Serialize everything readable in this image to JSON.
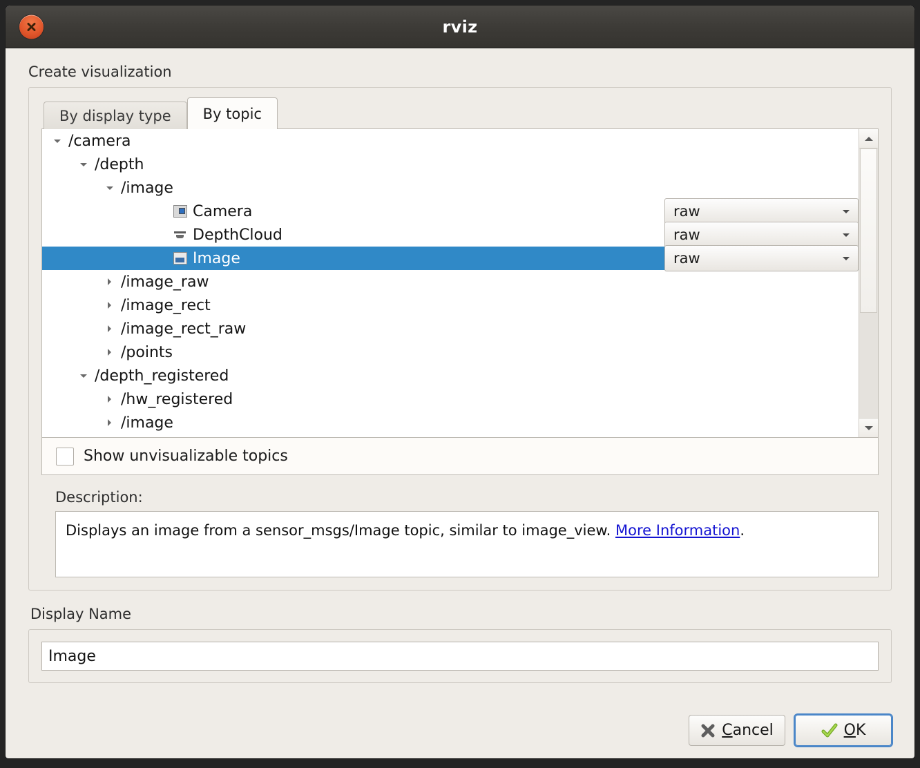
{
  "window": {
    "title": "rviz",
    "close_icon": "close-icon"
  },
  "group": {
    "title": "Create visualization"
  },
  "tabs": [
    {
      "label": "By display type",
      "active": false
    },
    {
      "label": "By topic",
      "active": true
    }
  ],
  "tree": {
    "rows": [
      {
        "label": "/camera",
        "indent": 0,
        "arrow": "down",
        "icon": "none",
        "selected": false,
        "combo": null
      },
      {
        "label": "/depth",
        "indent": 1,
        "arrow": "down",
        "icon": "none",
        "selected": false,
        "combo": null
      },
      {
        "label": "/image",
        "indent": 2,
        "arrow": "down",
        "icon": "none",
        "selected": false,
        "combo": null
      },
      {
        "label": "Camera",
        "indent": 4,
        "arrow": "none",
        "icon": "camera",
        "selected": false,
        "combo": "raw"
      },
      {
        "label": "DepthCloud",
        "indent": 4,
        "arrow": "none",
        "icon": "depthcloud",
        "selected": false,
        "combo": "raw"
      },
      {
        "label": "Image",
        "indent": 4,
        "arrow": "none",
        "icon": "image",
        "selected": true,
        "combo": "raw"
      },
      {
        "label": "/image_raw",
        "indent": 2,
        "arrow": "right",
        "icon": "none",
        "selected": false,
        "combo": null
      },
      {
        "label": "/image_rect",
        "indent": 2,
        "arrow": "right",
        "icon": "none",
        "selected": false,
        "combo": null
      },
      {
        "label": "/image_rect_raw",
        "indent": 2,
        "arrow": "right",
        "icon": "none",
        "selected": false,
        "combo": null
      },
      {
        "label": "/points",
        "indent": 2,
        "arrow": "right",
        "icon": "none",
        "selected": false,
        "combo": null
      },
      {
        "label": "/depth_registered",
        "indent": 1,
        "arrow": "down",
        "icon": "none",
        "selected": false,
        "combo": null
      },
      {
        "label": "/hw_registered",
        "indent": 2,
        "arrow": "right",
        "icon": "none",
        "selected": false,
        "combo": null
      },
      {
        "label": "/image",
        "indent": 2,
        "arrow": "right",
        "icon": "none",
        "selected": false,
        "combo": null
      }
    ],
    "scrollbar": {
      "up_icon": "scroll-up-icon",
      "down_icon": "scroll-down-icon",
      "thumb_position_percent": 0,
      "thumb_size_percent": 61
    }
  },
  "show_unvisualizable": {
    "label": "Show unvisualizable topics",
    "checked": false
  },
  "description": {
    "label": "Description:",
    "text_before_link": "Displays an image from a sensor_msgs/Image topic, similar to image_view. ",
    "link_text": "More Information",
    "text_after_link": "."
  },
  "display_name": {
    "label": "Display Name",
    "value": "Image"
  },
  "buttons": {
    "cancel": {
      "label": "Cancel",
      "mnemonic": "C",
      "rest": "ancel",
      "icon": "cancel-x-icon"
    },
    "ok": {
      "label": "OK",
      "mnemonic": "O",
      "rest": "K",
      "icon": "check-icon",
      "focused": true
    }
  },
  "colors": {
    "selection_blue": "#3089c7",
    "link_blue": "#1414d2",
    "window_bg": "#efece7",
    "titlebar_dark": "#3d3b37",
    "close_orange": "#e2572c",
    "ok_check_green": "#8fc23e"
  }
}
